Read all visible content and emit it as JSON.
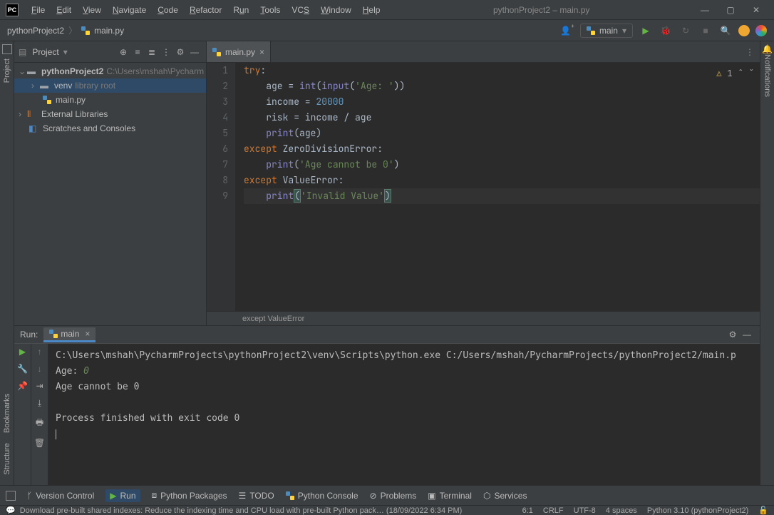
{
  "window": {
    "title": "pythonProject2 – main.py"
  },
  "menus": {
    "file": "File",
    "edit": "Edit",
    "view": "View",
    "navigate": "Navigate",
    "code": "Code",
    "refactor": "Refactor",
    "run": "Run",
    "tools": "Tools",
    "vcs": "VCS",
    "window": "Window",
    "help": "Help"
  },
  "breadcrumb": {
    "root": "pythonProject2",
    "file": "main.py"
  },
  "runConfig": {
    "name": "main"
  },
  "projectPane": {
    "title": "Project",
    "root": "pythonProject2",
    "rootPath": "C:\\Users\\mshah\\Pycharm",
    "venv": "venv",
    "venvNote": "library root",
    "file": "main.py",
    "extLibs": "External Libraries",
    "scratches": "Scratches and Consoles"
  },
  "editor": {
    "tab": "main.py",
    "lines": [
      "1",
      "2",
      "3",
      "4",
      "5",
      "6",
      "7",
      "8",
      "9"
    ],
    "inspections": "1",
    "breadcrumb": "except ValueError"
  },
  "code": {
    "l1a": "try",
    "l1b": ":",
    "l2a": "    age = ",
    "l2b": "int",
    "l2c": "(",
    "l2d": "input",
    "l2e": "(",
    "l2f": "'Age: '",
    "l2g": "))",
    "l3a": "    income = ",
    "l3b": "20000",
    "l4a": "    risk = income / age",
    "l5a": "    ",
    "l5b": "print",
    "l5c": "(age)",
    "l6a": "except ",
    "l6b": "ZeroDivisionError",
    "l6c": ":",
    "l7a": "    ",
    "l7b": "print",
    "l7c": "(",
    "l7d": "'Age cannot be 0'",
    "l7e": ")",
    "l8a": "except ",
    "l8b": "ValueError",
    "l8c": ":",
    "l9a": "    ",
    "l9b": "print",
    "l9c": "(",
    "l9d": "'Invalid Value'",
    "l9e": ")"
  },
  "run": {
    "label": "Run:",
    "tab": "main",
    "cmd": "C:\\Users\\mshah\\PycharmProjects\\pythonProject2\\venv\\Scripts\\python.exe C:/Users/mshah/PycharmProjects/pythonProject2/main.p",
    "prompt": "Age: ",
    "input": "0",
    "out1": "Age cannot be 0",
    "out2": "",
    "out3": "Process finished with exit code 0"
  },
  "bottomTools": {
    "vcs": "Version Control",
    "run": "Run",
    "pkgs": "Python Packages",
    "todo": "TODO",
    "console": "Python Console",
    "problems": "Problems",
    "terminal": "Terminal",
    "services": "Services"
  },
  "status": {
    "msg": "Download pre-built shared indexes: Reduce the indexing time and CPU load with pre-built Python pack… (18/09/2022 6:34 PM)",
    "pos": "6:1",
    "eol": "CRLF",
    "enc": "UTF-8",
    "indent": "4 spaces",
    "interp": "Python 3.10 (pythonProject2)"
  },
  "gutters": {
    "project": "Project",
    "bookmarks": "Bookmarks",
    "structure": "Structure",
    "notifications": "Notifications"
  }
}
